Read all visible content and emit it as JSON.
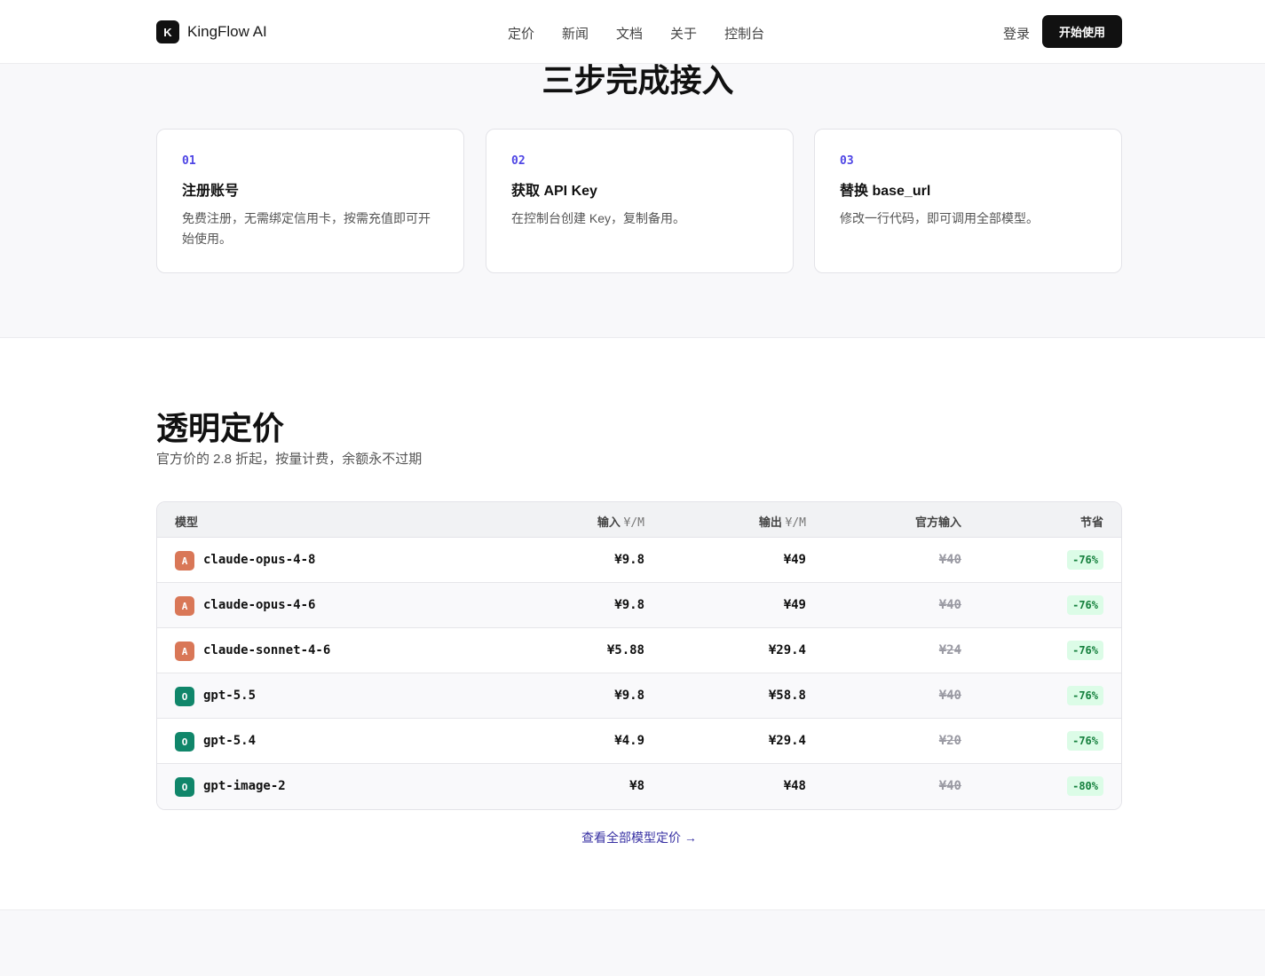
{
  "header": {
    "brand_logo": "K",
    "brand_name": "KingFlow AI",
    "nav": [
      "定价",
      "新闻",
      "文档",
      "关于",
      "控制台"
    ],
    "login": "登录",
    "cta": "开始使用"
  },
  "steps": {
    "title": "三步完成接入",
    "cards": [
      {
        "num": "01",
        "title": "注册账号",
        "desc": "免费注册，无需绑定信用卡，按需充值即可开始使用。"
      },
      {
        "num": "02",
        "title": "获取 API Key",
        "desc": "在控制台创建 Key，复制备用。"
      },
      {
        "num": "03",
        "title": "替换 base_url",
        "desc": "修改一行代码，即可调用全部模型。"
      }
    ]
  },
  "pricing": {
    "title": "透明定价",
    "subtitle": "官方价的 2.8 折起，按量计费，余额永不过期",
    "headers": {
      "model": "模型",
      "input": "输入",
      "input_unit": "¥/M",
      "output": "输出",
      "output_unit": "¥/M",
      "official": "官方输入",
      "save": "节省"
    },
    "rows": [
      {
        "provider": "A",
        "provider_color": "#d97757",
        "model": "claude-opus-4-8",
        "input": "¥9.8",
        "output": "¥49",
        "official": "¥40",
        "save": "-76%"
      },
      {
        "provider": "A",
        "provider_color": "#d97757",
        "model": "claude-opus-4-6",
        "input": "¥9.8",
        "output": "¥49",
        "official": "¥40",
        "save": "-76%"
      },
      {
        "provider": "A",
        "provider_color": "#d97757",
        "model": "claude-sonnet-4-6",
        "input": "¥5.88",
        "output": "¥29.4",
        "official": "¥24",
        "save": "-76%"
      },
      {
        "provider": "O",
        "provider_color": "#10866a",
        "model": "gpt-5.5",
        "input": "¥9.8",
        "output": "¥58.8",
        "official": "¥40",
        "save": "-76%"
      },
      {
        "provider": "O",
        "provider_color": "#10866a",
        "model": "gpt-5.4",
        "input": "¥4.9",
        "output": "¥29.4",
        "official": "¥20",
        "save": "-76%"
      },
      {
        "provider": "O",
        "provider_color": "#10866a",
        "model": "gpt-image-2",
        "input": "¥8",
        "output": "¥48",
        "official": "¥40",
        "save": "-80%"
      }
    ],
    "view_all": "查看全部模型定价 →"
  }
}
